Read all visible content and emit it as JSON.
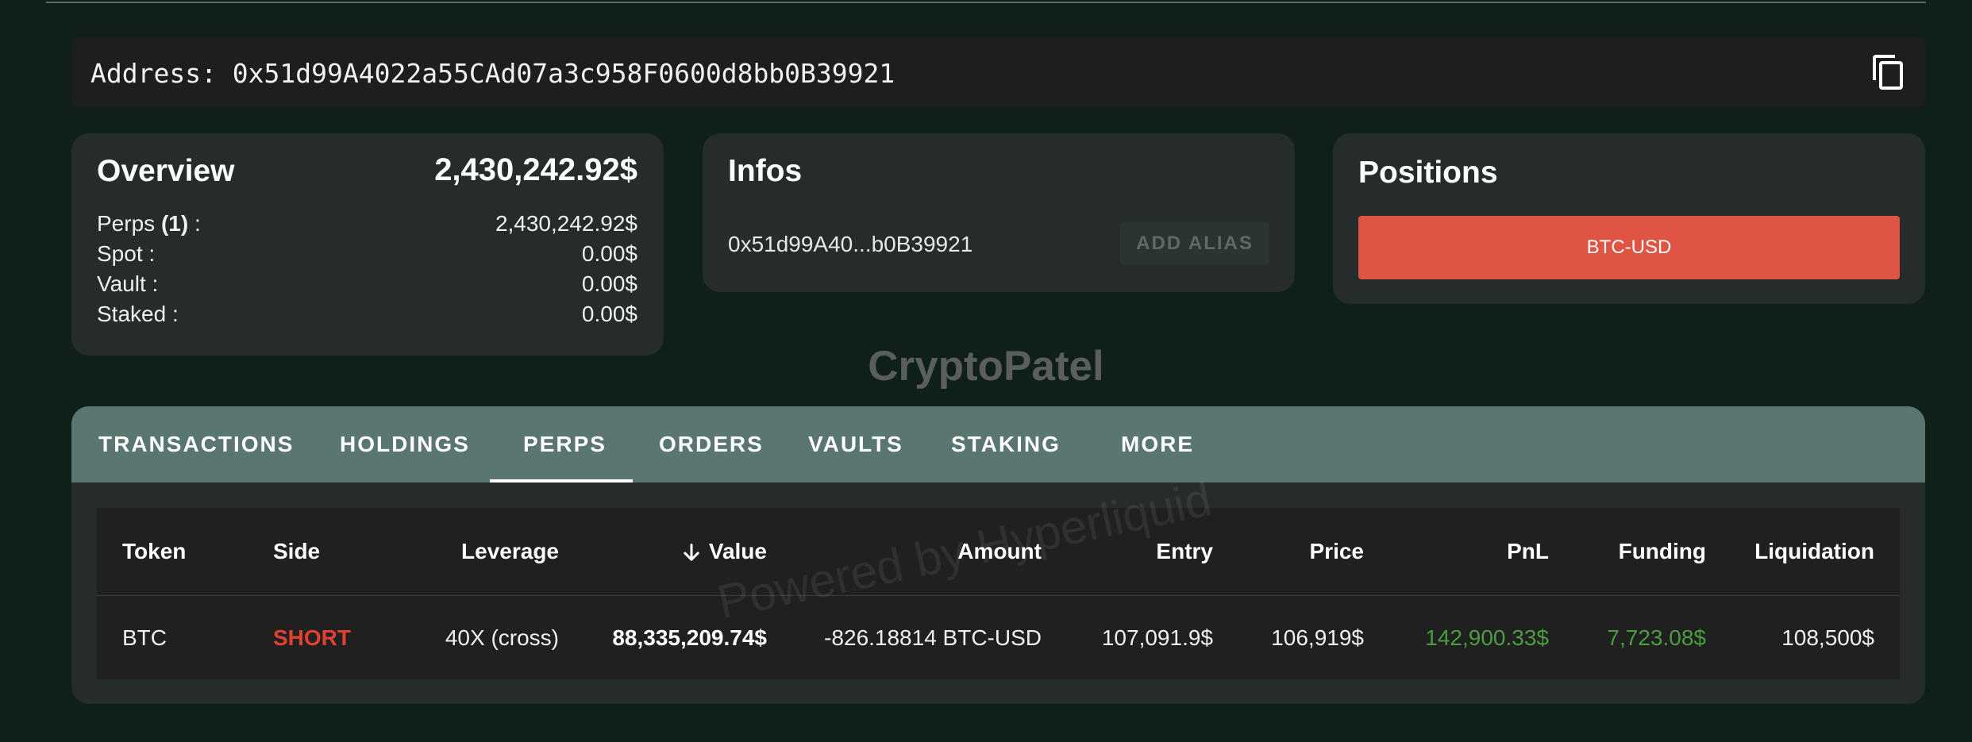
{
  "address": {
    "label": "Address: 0x51d99A4022a55CAd07a3c958F0600d8bb0B39921",
    "copy_icon": "copy-icon"
  },
  "overview": {
    "title": "Overview",
    "total": "2,430,242.92$",
    "rows": [
      {
        "label": "Perps",
        "count": "(1)",
        "suffix": " :",
        "value": "2,430,242.92$"
      },
      {
        "label": "Spot :",
        "value": "0.00$"
      },
      {
        "label": "Vault :",
        "value": "0.00$"
      },
      {
        "label": "Staked :",
        "value": "0.00$"
      }
    ]
  },
  "infos": {
    "title": "Infos",
    "short_address": "0x51d99A40...b0B39921",
    "alias_button": "ADD ALIAS"
  },
  "positions": {
    "title": "Positions",
    "items": [
      "BTC-USD"
    ]
  },
  "watermark": {
    "brand": "CryptoPatel",
    "powered": "Powered by Hyperliquid"
  },
  "tabs": {
    "active": "PERPS",
    "items": [
      "TRANSACTIONS",
      "HOLDINGS",
      "PERPS",
      "ORDERS",
      "VAULTS",
      "STAKING",
      "MORE"
    ]
  },
  "table": {
    "sort_icon": "arrow-down-icon",
    "headers": [
      "Token",
      "Side",
      "Leverage",
      "Value",
      "Amount",
      "Entry",
      "Price",
      "PnL",
      "Funding",
      "Liquidation"
    ],
    "rows": [
      {
        "token": "BTC",
        "side": "SHORT",
        "leverage": "40X (cross)",
        "value": "88,335,209.74$",
        "amount": "-826.18814 BTC-USD",
        "entry": "107,091.9$",
        "price": "106,919$",
        "pnl": "142,900.33$",
        "funding": "7,723.08$",
        "liquidation": "108,500$"
      }
    ]
  },
  "colors": {
    "background": "#0f2019",
    "card": "#252c2b",
    "tab_bar": "#5a7670",
    "short": "#e04132",
    "positive": "#4a9e3f",
    "position_button": "#e05443"
  }
}
